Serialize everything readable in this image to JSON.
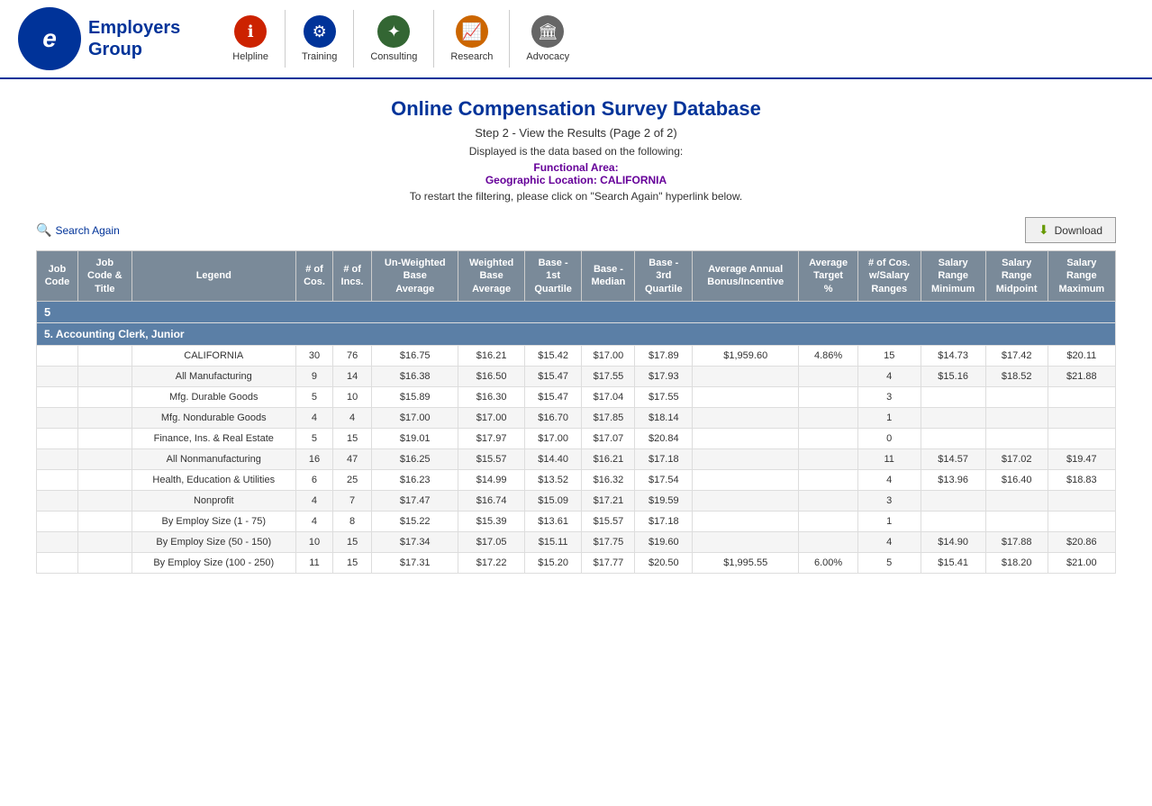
{
  "header": {
    "logo_letter": "e",
    "logo_text_line1": "Employers",
    "logo_text_line2": "Group",
    "nav_items": [
      {
        "label": "Helpline",
        "icon": "ℹ",
        "icon_class": "red"
      },
      {
        "label": "Training",
        "icon": "👥",
        "icon_class": "blue"
      },
      {
        "label": "Consulting",
        "icon": "🌱",
        "icon_class": "green"
      },
      {
        "label": "Research",
        "icon": "📊",
        "icon_class": "orange"
      },
      {
        "label": "Advocacy",
        "icon": "🏛",
        "icon_class": "gray"
      }
    ]
  },
  "page": {
    "title": "Online Compensation Survey Database",
    "subtitle": "Step 2 - View the Results (Page 2 of 2)",
    "info": "Displayed is the data based on the following:",
    "functional_area_label": "Functional Area:",
    "geo_label": "Geographic Location: CALIFORNIA",
    "note": "To restart the filtering, please click on \"Search Again\" hyperlink below.",
    "search_again_label": "Search Again",
    "download_label": "Download"
  },
  "table": {
    "headers": [
      "Job Code",
      "Job Code & Title",
      "Legend",
      "# of Cos.",
      "# of Incs.",
      "Un-Weighted Base Average",
      "Weighted Base Average",
      "Base - 1st Quartile",
      "Base - Median",
      "Base - 3rd Quartile",
      "Average Annual Bonus/Incentive",
      "Average Target %",
      "# of Cos. w/Salary Ranges",
      "Salary Range Minimum",
      "Salary Range Midpoint",
      "Salary Range Maximum"
    ],
    "row_number": "5",
    "group_title": "5. Accounting Clerk, Junior",
    "rows": [
      {
        "legend": "CALIFORNIA",
        "cos": "30",
        "incs": "76",
        "uw_avg": "$16.75",
        "w_avg": "$16.21",
        "q1": "$15.42",
        "median": "$17.00",
        "q3": "$17.89",
        "bonus": "$1,959.60",
        "target": "4.86%",
        "cos_sr": "15",
        "sr_min": "$14.73",
        "sr_mid": "$17.42",
        "sr_max": "$20.11"
      },
      {
        "legend": "All Manufacturing",
        "cos": "9",
        "incs": "14",
        "uw_avg": "$16.38",
        "w_avg": "$16.50",
        "q1": "$15.47",
        "median": "$17.55",
        "q3": "$17.93",
        "bonus": "",
        "target": "",
        "cos_sr": "4",
        "sr_min": "$15.16",
        "sr_mid": "$18.52",
        "sr_max": "$21.88"
      },
      {
        "legend": "Mfg. Durable Goods",
        "cos": "5",
        "incs": "10",
        "uw_avg": "$15.89",
        "w_avg": "$16.30",
        "q1": "$15.47",
        "median": "$17.04",
        "q3": "$17.55",
        "bonus": "",
        "target": "",
        "cos_sr": "3",
        "sr_min": "",
        "sr_mid": "",
        "sr_max": ""
      },
      {
        "legend": "Mfg. Nondurable Goods",
        "cos": "4",
        "incs": "4",
        "uw_avg": "$17.00",
        "w_avg": "$17.00",
        "q1": "$16.70",
        "median": "$17.85",
        "q3": "$18.14",
        "bonus": "",
        "target": "",
        "cos_sr": "1",
        "sr_min": "",
        "sr_mid": "",
        "sr_max": ""
      },
      {
        "legend": "Finance, Ins. & Real Estate",
        "cos": "5",
        "incs": "15",
        "uw_avg": "$19.01",
        "w_avg": "$17.97",
        "q1": "$17.00",
        "median": "$17.07",
        "q3": "$20.84",
        "bonus": "",
        "target": "",
        "cos_sr": "0",
        "sr_min": "",
        "sr_mid": "",
        "sr_max": ""
      },
      {
        "legend": "All Nonmanufacturing",
        "cos": "16",
        "incs": "47",
        "uw_avg": "$16.25",
        "w_avg": "$15.57",
        "q1": "$14.40",
        "median": "$16.21",
        "q3": "$17.18",
        "bonus": "",
        "target": "",
        "cos_sr": "11",
        "sr_min": "$14.57",
        "sr_mid": "$17.02",
        "sr_max": "$19.47"
      },
      {
        "legend": "Health, Education & Utilities",
        "cos": "6",
        "incs": "25",
        "uw_avg": "$16.23",
        "w_avg": "$14.99",
        "q1": "$13.52",
        "median": "$16.32",
        "q3": "$17.54",
        "bonus": "",
        "target": "",
        "cos_sr": "4",
        "sr_min": "$13.96",
        "sr_mid": "$16.40",
        "sr_max": "$18.83"
      },
      {
        "legend": "Nonprofit",
        "cos": "4",
        "incs": "7",
        "uw_avg": "$17.47",
        "w_avg": "$16.74",
        "q1": "$15.09",
        "median": "$17.21",
        "q3": "$19.59",
        "bonus": "",
        "target": "",
        "cos_sr": "3",
        "sr_min": "",
        "sr_mid": "",
        "sr_max": ""
      },
      {
        "legend": "By Employ Size (1 - 75)",
        "cos": "4",
        "incs": "8",
        "uw_avg": "$15.22",
        "w_avg": "$15.39",
        "q1": "$13.61",
        "median": "$15.57",
        "q3": "$17.18",
        "bonus": "",
        "target": "",
        "cos_sr": "1",
        "sr_min": "",
        "sr_mid": "",
        "sr_max": ""
      },
      {
        "legend": "By Employ Size (50 - 150)",
        "cos": "10",
        "incs": "15",
        "uw_avg": "$17.34",
        "w_avg": "$17.05",
        "q1": "$15.11",
        "median": "$17.75",
        "q3": "$19.60",
        "bonus": "",
        "target": "",
        "cos_sr": "4",
        "sr_min": "$14.90",
        "sr_mid": "$17.88",
        "sr_max": "$20.86"
      },
      {
        "legend": "By Employ Size (100 - 250)",
        "cos": "11",
        "incs": "15",
        "uw_avg": "$17.31",
        "w_avg": "$17.22",
        "q1": "$15.20",
        "median": "$17.77",
        "q3": "$20.50",
        "bonus": "$1,995.55",
        "target": "6.00%",
        "cos_sr": "5",
        "sr_min": "$15.41",
        "sr_mid": "$18.20",
        "sr_max": "$21.00"
      }
    ]
  }
}
